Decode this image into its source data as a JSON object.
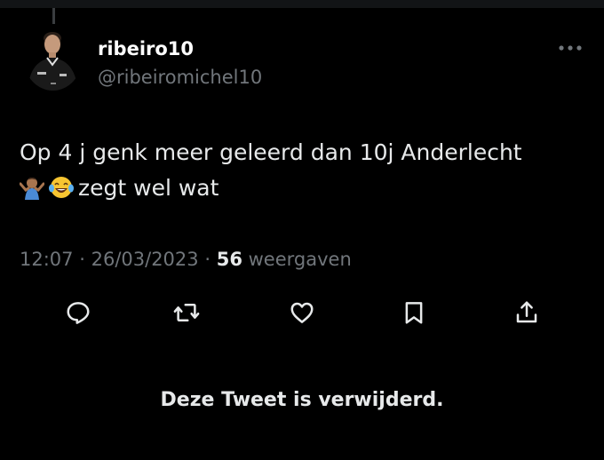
{
  "tweet": {
    "author": {
      "display_name": "ribeiro10",
      "handle": "@ribeiromichel10",
      "avatar_icon": "avatar-photo"
    },
    "more_icon": "more-horizontal-icon",
    "text_line_1": "Op 4 j genk meer geleerd dan 10j Anderlecht",
    "text_line_2": "zegt wel wat",
    "emojis": [
      "person-shrugging-emoji",
      "face-with-tears-of-joy-emoji"
    ],
    "meta": {
      "time": "12:07",
      "separator": "·",
      "date": "26/03/2023",
      "views_count": "56",
      "views_label": "weergaven"
    },
    "actions": [
      {
        "name": "reply",
        "icon": "reply-icon"
      },
      {
        "name": "retweet",
        "icon": "retweet-icon"
      },
      {
        "name": "like",
        "icon": "heart-icon"
      },
      {
        "name": "bookmark",
        "icon": "bookmark-icon"
      },
      {
        "name": "share",
        "icon": "share-icon"
      }
    ]
  },
  "deleted_notice": "Deze Tweet is verwijderd.",
  "colors": {
    "background": "#000000",
    "text": "#e7e9ea",
    "secondary": "#71767b",
    "top_band": "#121416"
  }
}
